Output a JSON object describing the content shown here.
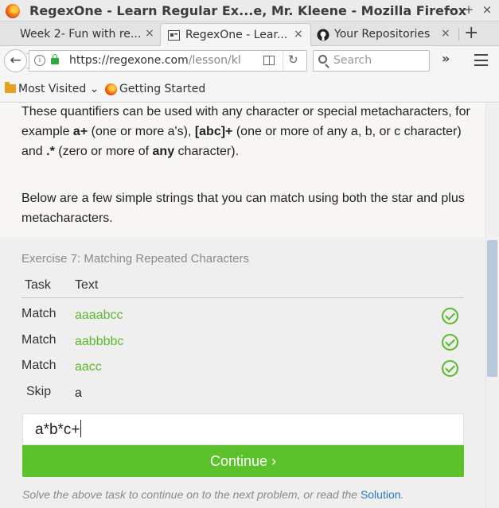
{
  "window": {
    "title": "RegexOne - Learn Regular Ex...e, Mr. Kleene - Mozilla Firefox",
    "minimize": "−",
    "maximize": "+",
    "close": "×"
  },
  "tabs": [
    {
      "label": "Week 2- Fun with re...",
      "close": "×",
      "active": false
    },
    {
      "label": "RegexOne - Lear...",
      "close": "×",
      "active": true
    },
    {
      "label": "Your Repositories",
      "close": "×",
      "active": false
    }
  ],
  "new_tab": "+",
  "navbar": {
    "back": "←",
    "url_host": "https://regexone.com",
    "url_path": "/lesson/kl",
    "reload": "↻",
    "search_placeholder": "Search",
    "overflow": "»"
  },
  "bookmarks": {
    "most_visited": "Most Visited",
    "chevron": "⌄",
    "getting_started": "Getting Started"
  },
  "content": {
    "p1": {
      "t1": "These quantifiers can be used with any character or special metacharacters, for example ",
      "b1": "a+",
      "t2": " (one or more a's), ",
      "b2": "[abc]+",
      "t3": " (one or more of any a, b, or c character) and ",
      "b3": ".*",
      "t4": " (zero or more of ",
      "b4": "any",
      "t5": " character)."
    },
    "p2": "Below are a few simple strings that you can match using both the star and plus metacharacters."
  },
  "exercise": {
    "title": "Exercise 7: Matching Repeated Characters",
    "col_task": "Task",
    "col_text": "Text",
    "rows": [
      {
        "task": "Match",
        "text": "aaaabcc",
        "status": "matched"
      },
      {
        "task": "Match",
        "text": "aabbbbc",
        "status": "matched"
      },
      {
        "task": "Match",
        "text": "aacc",
        "status": "matched"
      },
      {
        "task": "Skip",
        "text": "a",
        "status": "skipped"
      }
    ],
    "input_value": "a*b*c+",
    "continue_label": "Continue ›",
    "hint_prefix": "Solve the above task to continue on to the next problem, or read the ",
    "hint_link": "Solution",
    "hint_suffix": "."
  },
  "colors": {
    "accent_green": "#5cc22b",
    "match_text": "#5cb82b",
    "link": "#2b73c7"
  }
}
